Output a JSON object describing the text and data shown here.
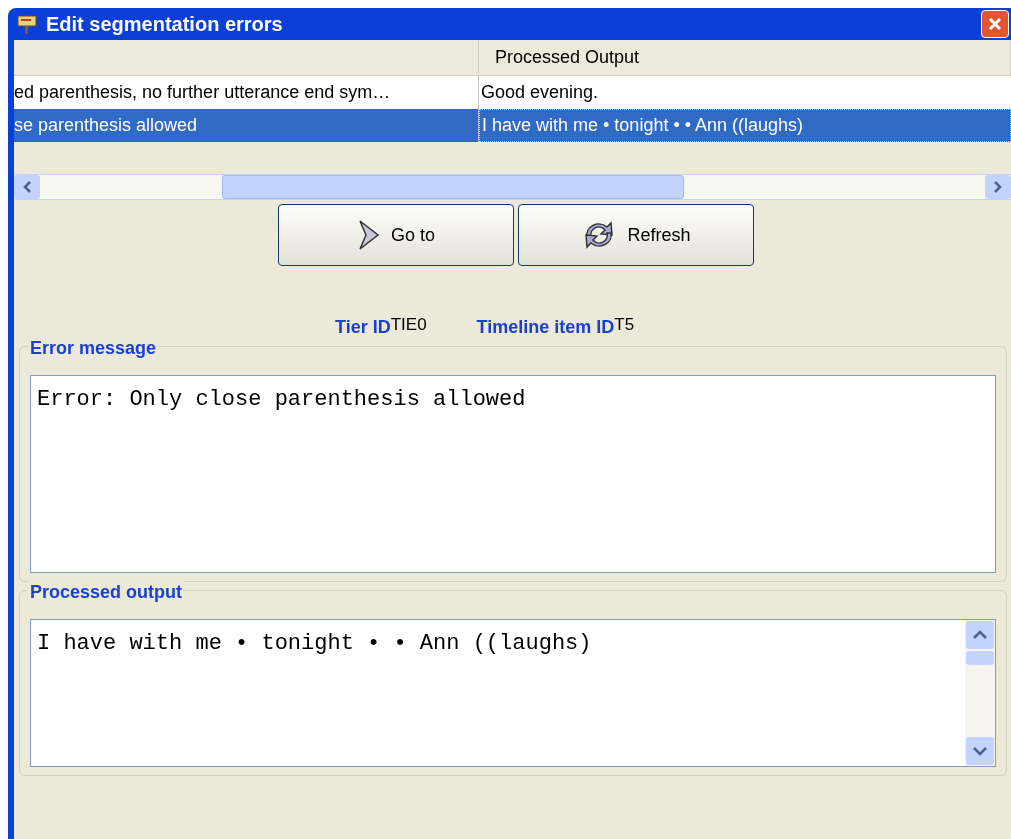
{
  "window": {
    "title": "Edit segmentation errors"
  },
  "table": {
    "columns": [
      {},
      {
        "label": "Processed Output"
      }
    ],
    "rows": [
      {
        "cells": [
          "ed parenthesis, no further utterance end sym…",
          "Good evening."
        ],
        "selected": false
      },
      {
        "cells": [
          "se parenthesis allowed",
          "I have with me • tonight • • Ann ((laughs)"
        ],
        "selected": true
      }
    ]
  },
  "buttons": [
    {
      "label": "Go to",
      "kind": "chevron"
    },
    {
      "label": "Refresh",
      "kind": "refresh"
    }
  ],
  "ids": [
    {
      "label": "Tier ID",
      "value": "TIE0"
    },
    {
      "label": "Timeline item ID",
      "value": "T5"
    }
  ],
  "groups": [
    {
      "title": "Error message",
      "value": "Error: Only close parenthesis allowed",
      "scrollable": false
    },
    {
      "title": "Processed output",
      "value": "I have with me • tonight • • Ann ((laughs)",
      "scrollable": true
    }
  ]
}
